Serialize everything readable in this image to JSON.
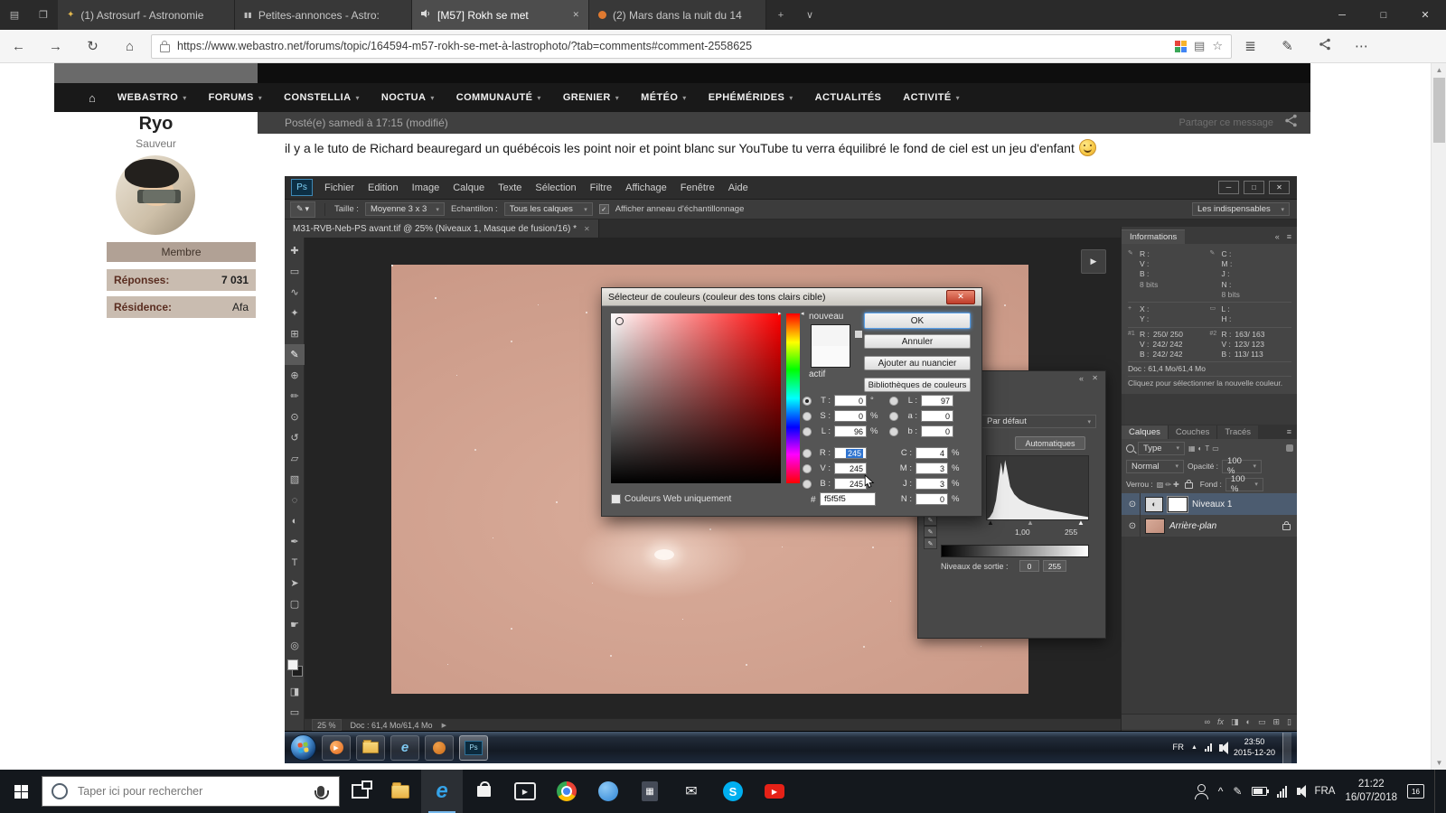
{
  "window": {
    "tabs": [
      {
        "title": "(1) Astrosurf - Astronomie"
      },
      {
        "title": "Petites-annonces - Astro:"
      },
      {
        "title": "[M57] Rokh se met"
      },
      {
        "title": "(2) Mars dans la nuit du 14"
      }
    ],
    "url": "https://www.webastro.net/forums/topic/164594-m57-rokh-se-met-à-lastrophoto/?tab=comments#comment-2558625"
  },
  "forum": {
    "nav": [
      "WEBASTRO",
      "FORUMS",
      "CONSTELLIA",
      "NOCTUA",
      "COMMUNAUTÉ",
      "GRENIER",
      "MÉTÉO",
      "EPHÉMÉRIDES",
      "ACTUALITÉS",
      "ACTIVITÉ"
    ],
    "post_meta": "Posté(e) samedi à 17:15 (modifié)",
    "share_label": "Partager ce message",
    "author": {
      "name": "Ryo",
      "flair": "Sauveur",
      "badge": "Membre",
      "stat1_label": "Réponses:",
      "stat1_value": "7 031",
      "stat2_label": "Résidence:",
      "stat2_value": "Afa"
    },
    "body": "il y a le tuto de Richard beauregard un québécois les point noir et point blanc sur YouTube tu verra équilibré le fond de ciel est un jeu d'enfant"
  },
  "ps": {
    "logo": "Ps",
    "menus": [
      "Fichier",
      "Edition",
      "Image",
      "Calque",
      "Texte",
      "Sélection",
      "Filtre",
      "Affichage",
      "Fenêtre",
      "Aide"
    ],
    "options": {
      "size_label": "Taille :",
      "size_value": "Moyenne 3 x 3",
      "sample_label": "Echantillon :",
      "sample_value": "Tous les calques",
      "ring_label": "Afficher anneau d'échantillonnage",
      "workspace": "Les indispensables"
    },
    "doc_tab": "M31-RVB-Neb-PS avant.tif @ 25% (Niveaux 1, Masque de fusion/16) *",
    "tools": [
      {
        "name": "move",
        "g": "✚"
      },
      {
        "name": "marquee",
        "g": "▭"
      },
      {
        "name": "lasso",
        "g": "∿"
      },
      {
        "name": "quick-select",
        "g": "✦"
      },
      {
        "name": "crop",
        "g": "⊞"
      },
      {
        "name": "eyedropper",
        "g": "✎"
      },
      {
        "name": "heal",
        "g": "⊕"
      },
      {
        "name": "brush",
        "g": "✏"
      },
      {
        "name": "clone",
        "g": "⊙"
      },
      {
        "name": "history-brush",
        "g": "↺"
      },
      {
        "name": "eraser",
        "g": "▱"
      },
      {
        "name": "gradient",
        "g": "▧"
      },
      {
        "name": "blur",
        "g": "◌"
      },
      {
        "name": "dodge",
        "g": "◐"
      },
      {
        "name": "pen",
        "g": "✒"
      },
      {
        "name": "type",
        "g": "T"
      },
      {
        "name": "path-select",
        "g": "➤"
      },
      {
        "name": "shape",
        "g": "▢"
      },
      {
        "name": "hand",
        "g": "☛"
      },
      {
        "name": "zoom",
        "g": "◎"
      }
    ],
    "status_zoom": "25 %",
    "status_doc": "Doc : 61,4 Mo/61,4 Mo",
    "info": {
      "title": "Informations",
      "r": "R :",
      "v": "V :",
      "b": "B :",
      "c": "C :",
      "m": "M :",
      "j": "J :",
      "n": "N :",
      "bits": "8 bits",
      "x": "X :",
      "y": "Y :",
      "l": "L :",
      "h": "H :",
      "s1": "#1",
      "s2": "#2",
      "s1r": "250/ 250",
      "s1v": "242/ 242",
      "s1b": "242/ 242",
      "s2r": "163/ 163",
      "s2v": "123/ 123",
      "s2b": "113/ 113",
      "doc": "Doc : 61,4 Mo/61,4 Mo",
      "hint": "Cliquez pour sélectionner la nouvelle couleur."
    },
    "layers": {
      "tab1": "Calques",
      "tab2": "Couches",
      "tab3": "Tracés",
      "kind": "Type",
      "blend": "Normal",
      "opacity_label": "Opacité :",
      "opacity": "100 %",
      "lock_label": "Verrou :",
      "fill_label": "Fond :",
      "fill": "100 %",
      "layer1": "Niveaux 1",
      "layer2": "Arrière-plan"
    },
    "levels": {
      "preset": "Par défaut",
      "auto": "Automatiques",
      "mid": "1,00",
      "high": "255",
      "out_label": "Niveaux de sortie :",
      "out_low": "0",
      "out_high": "255"
    },
    "picker": {
      "title": "Sélecteur de couleurs (couleur des tons clairs cible)",
      "new_label": "nouveau",
      "active_label": "actif",
      "ok": "OK",
      "cancel": "Annuler",
      "add": "Ajouter au nuancier",
      "lib": "Bibliothèques de couleurs",
      "rows_left": [
        {
          "l": "T :",
          "v": "0",
          "u": "°"
        },
        {
          "l": "S :",
          "v": "0",
          "u": "%"
        },
        {
          "l": "L :",
          "v": "96",
          "u": "%"
        },
        {
          "l": "R :",
          "v": "245",
          "u": ""
        },
        {
          "l": "V :",
          "v": "245",
          "u": ""
        },
        {
          "l": "B :",
          "v": "245",
          "u": ""
        }
      ],
      "rows_right": [
        {
          "l": "L :",
          "v": "97",
          "u": ""
        },
        {
          "l": "a :",
          "v": "0",
          "u": ""
        },
        {
          "l": "b :",
          "v": "0",
          "u": ""
        },
        {
          "l": "C :",
          "v": "4",
          "u": "%"
        },
        {
          "l": "M :",
          "v": "3",
          "u": "%"
        },
        {
          "l": "J :",
          "v": "3",
          "u": "%"
        },
        {
          "l": "N :",
          "v": "0",
          "u": "%"
        }
      ],
      "web_only": "Couleurs Web uniquement",
      "hex_label": "#",
      "hex": "f5f5f5"
    },
    "win7": {
      "lang": "FR",
      "time": "23:50",
      "date": "2015-12-20",
      "ie": "e",
      "ps": "Ps"
    }
  },
  "taskbar": {
    "search_placeholder": "Taper ici pour rechercher",
    "lang": "FRA",
    "time": "21:22",
    "date": "16/07/2018",
    "badge": "16",
    "edge": "e",
    "skype": "S",
    "calc": "▦",
    "mail": "✉"
  },
  "glyphs": {
    "grid": "▤",
    "aside": "❐",
    "star_fav": "✦",
    "pause": "▮▮",
    "close": "✕",
    "plus": "+",
    "vee": "∨",
    "min": "─",
    "max": "□",
    "back": "←",
    "forward": "→",
    "refresh": "↻",
    "home_btn": "⌂",
    "book": "▤",
    "star": "☆",
    "hub": "≣",
    "pen": "✎",
    "more": "⋯",
    "home": "⌂",
    "caret": "▾",
    "check": "✓",
    "panel_menu": "≡",
    "collapse": "«",
    "play": "▶",
    "eye": "⊙",
    "adj": "◐",
    "up_tri": "▲",
    "mini_dropper": "✎",
    "plus_mini": "+",
    "rect_mini": "▭",
    "link": "∞",
    "fx": "fx",
    "mask": "◨",
    "group": "▭",
    "newlayer": "⊞",
    "trash": "▯",
    "filter_icons": "▦◐T▭",
    "lock_icons": "▨✏✚",
    "chev_up": "^"
  },
  "colors": {
    "picker_hex": "#f5f5f5",
    "selection_blue": "#2f74d0",
    "canvas_tint": "#cc9b89"
  }
}
